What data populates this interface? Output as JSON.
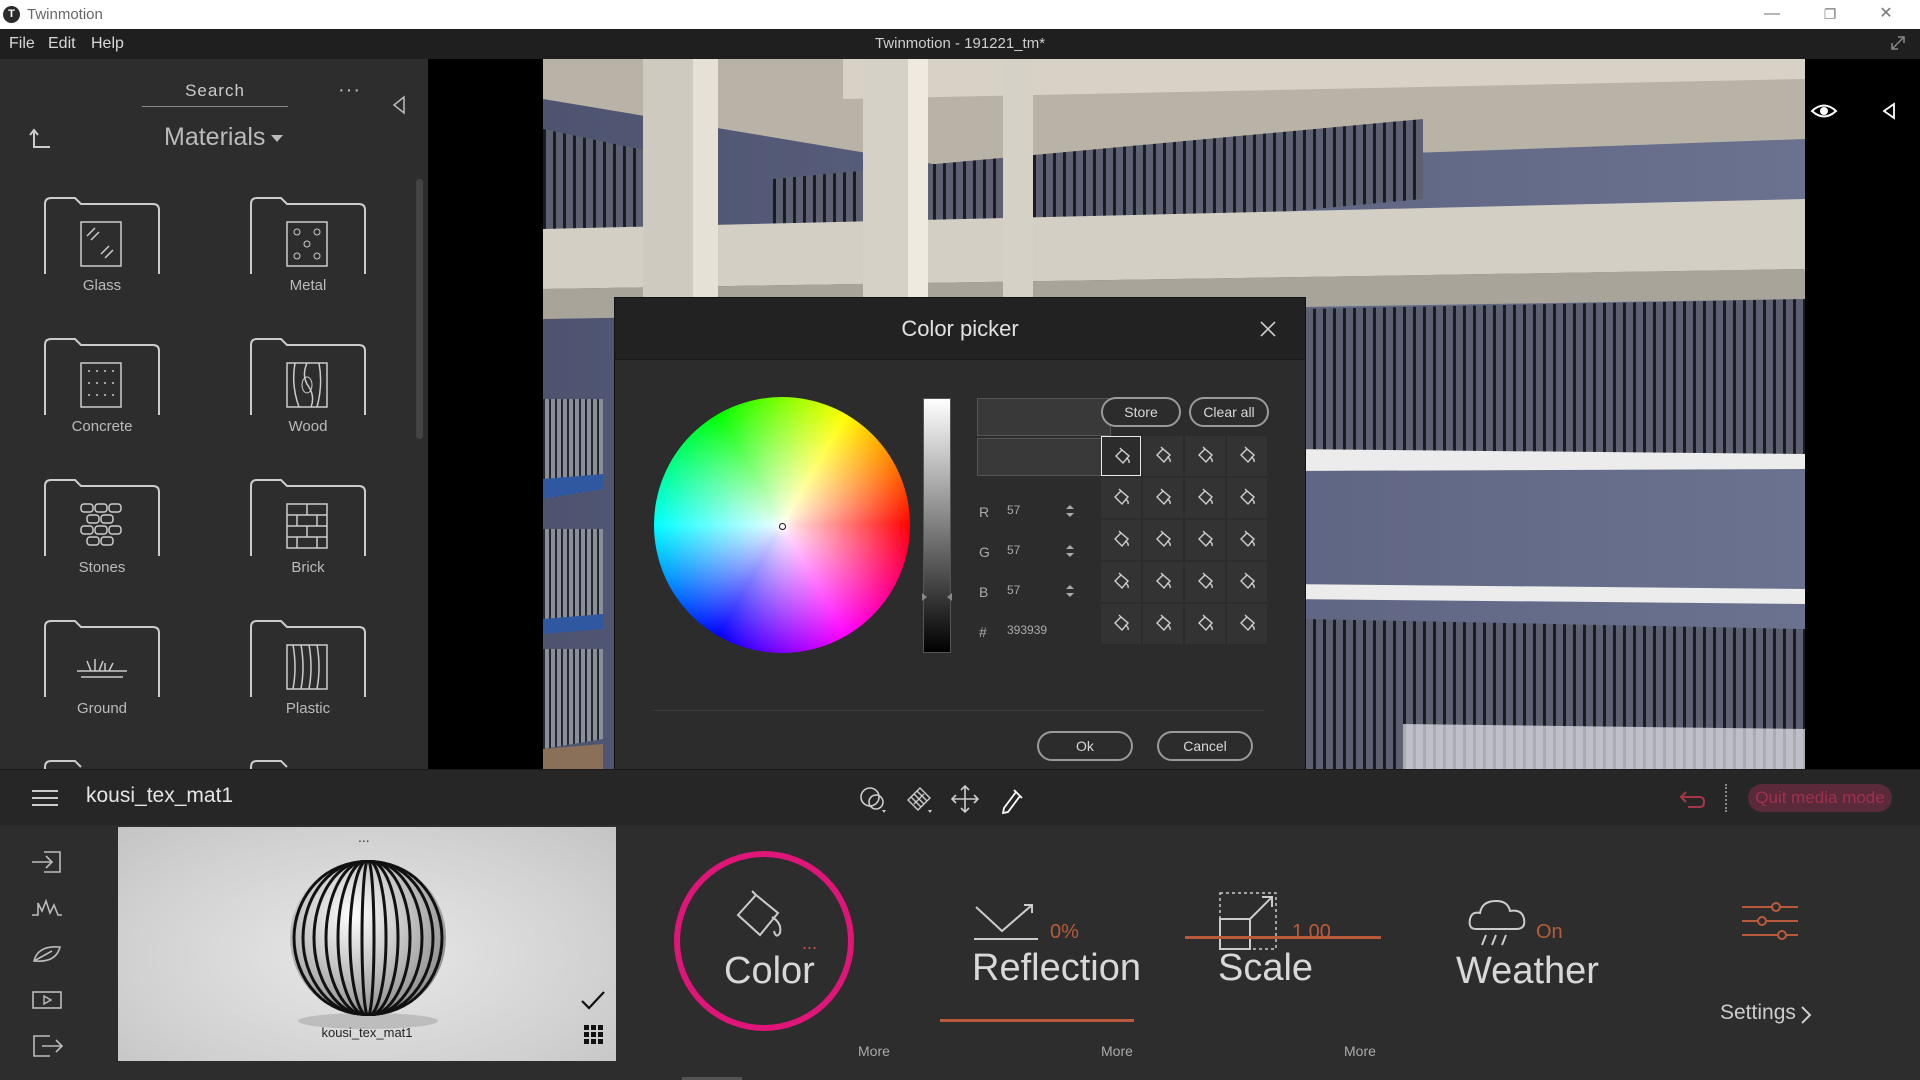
{
  "window": {
    "app_title": "Twinmotion",
    "logo_glyph": "T",
    "minimize": "—",
    "restore": "❐",
    "close": "✕"
  },
  "menubar": {
    "items": [
      "File",
      "Edit",
      "Help"
    ],
    "document_title": "Twinmotion - 191221_tm*"
  },
  "library": {
    "search_label": "Search",
    "more": "···",
    "category": "Materials",
    "folders": [
      {
        "label": "Glass",
        "icon": "glass-icon"
      },
      {
        "label": "Metal",
        "icon": "metal-icon"
      },
      {
        "label": "Concrete",
        "icon": "concrete-icon"
      },
      {
        "label": "Wood",
        "icon": "wood-icon"
      },
      {
        "label": "Stones",
        "icon": "stones-icon"
      },
      {
        "label": "Brick",
        "icon": "brick-icon"
      },
      {
        "label": "Ground",
        "icon": "ground-icon"
      },
      {
        "label": "Plastic",
        "icon": "plastic-icon"
      }
    ]
  },
  "color_picker": {
    "title": "Color picker",
    "r_label": "R",
    "r_value": "57",
    "g_label": "G",
    "g_value": "57",
    "b_label": "B",
    "b_value": "57",
    "hex_label": "#",
    "hex_value": "393939",
    "current_color": "#393939",
    "store_label": "Store",
    "clear_label": "Clear all",
    "ok_label": "Ok",
    "cancel_label": "Cancel",
    "swatch_rows": 5,
    "swatch_cols": 4
  },
  "toolbar": {
    "material_name": "kousi_tex_mat1",
    "quit_label": "Quit media mode",
    "accent": "#e0157a"
  },
  "material_editor": {
    "preview_dots": "...",
    "preview_name": "kousi_tex_mat1",
    "color_label": "Color",
    "color_dots": "...",
    "reflection_label": "Reflection",
    "reflection_value": "0%",
    "scale_label": "Scale",
    "scale_value": "1.00",
    "weather_label": "Weather",
    "weather_value": "On",
    "settings_label": "Settings",
    "more_label": "More"
  }
}
